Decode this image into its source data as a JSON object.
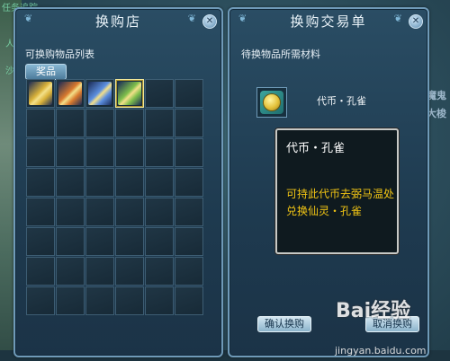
{
  "shop_panel": {
    "title": "换购店",
    "list_label": "可换购物品列表",
    "tab_label": "奖品",
    "items": [
      {
        "icon": "scroll-icon",
        "selected": false,
        "color": "#d9b23a"
      },
      {
        "icon": "scroll-icon",
        "selected": false,
        "color": "#d97a2e"
      },
      {
        "icon": "scroll-icon",
        "selected": false,
        "color": "#5c8fe0"
      },
      {
        "icon": "scroll-icon",
        "selected": true,
        "color": "#7fbf4c"
      }
    ],
    "grid_rows": 8,
    "grid_cols": 6
  },
  "order_panel": {
    "title": "换购交易单",
    "materials_label": "待换物品所需材料",
    "material_name": "代币・孔雀",
    "confirm_label": "确认换购",
    "cancel_label": "取消换购"
  },
  "tooltip": {
    "title": "代币・孔雀",
    "description": "可持此代币去弼马温处兑换仙灵・孔雀"
  },
  "background": {
    "left_text": [
      "任务追踪",
      "人",
      "沙"
    ],
    "right_text": [
      "魔鬼",
      "大梭"
    ]
  },
  "watermark": {
    "brand": "Bai经验",
    "url": "jingyan.baidu.com"
  },
  "colors": {
    "panel_border": "#6f9ab8",
    "tooltip_text": "#f2c514"
  }
}
